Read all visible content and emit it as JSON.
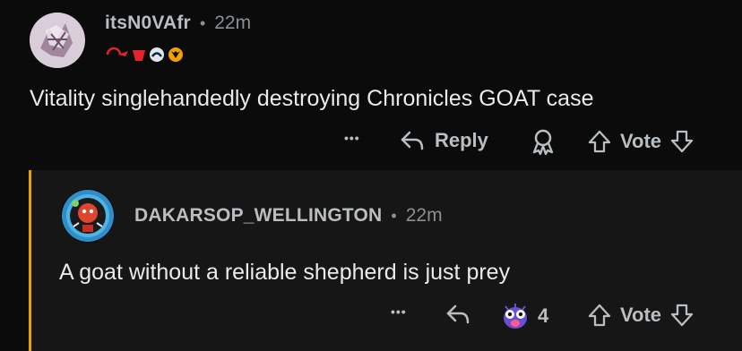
{
  "comment": {
    "username": "itsN0VAfr",
    "separator": "•",
    "time": "22m",
    "text": "Vitality singlehandedly destroying Chronicles GOAT case",
    "more_label": "•••",
    "reply_label": "Reply",
    "vote_label": "Vote"
  },
  "reply": {
    "username": "DAKARSOP_WELLINGTON",
    "separator": "•",
    "time": "22m",
    "text": "A goat without a reliable shepherd is just prey",
    "more_label": "•••",
    "award_count": "4",
    "vote_label": "Vote"
  },
  "colors": {
    "background": "#0b0b0b",
    "reply_background": "#161616",
    "thread_line": "#e3a300",
    "muted": "#8a9094"
  }
}
